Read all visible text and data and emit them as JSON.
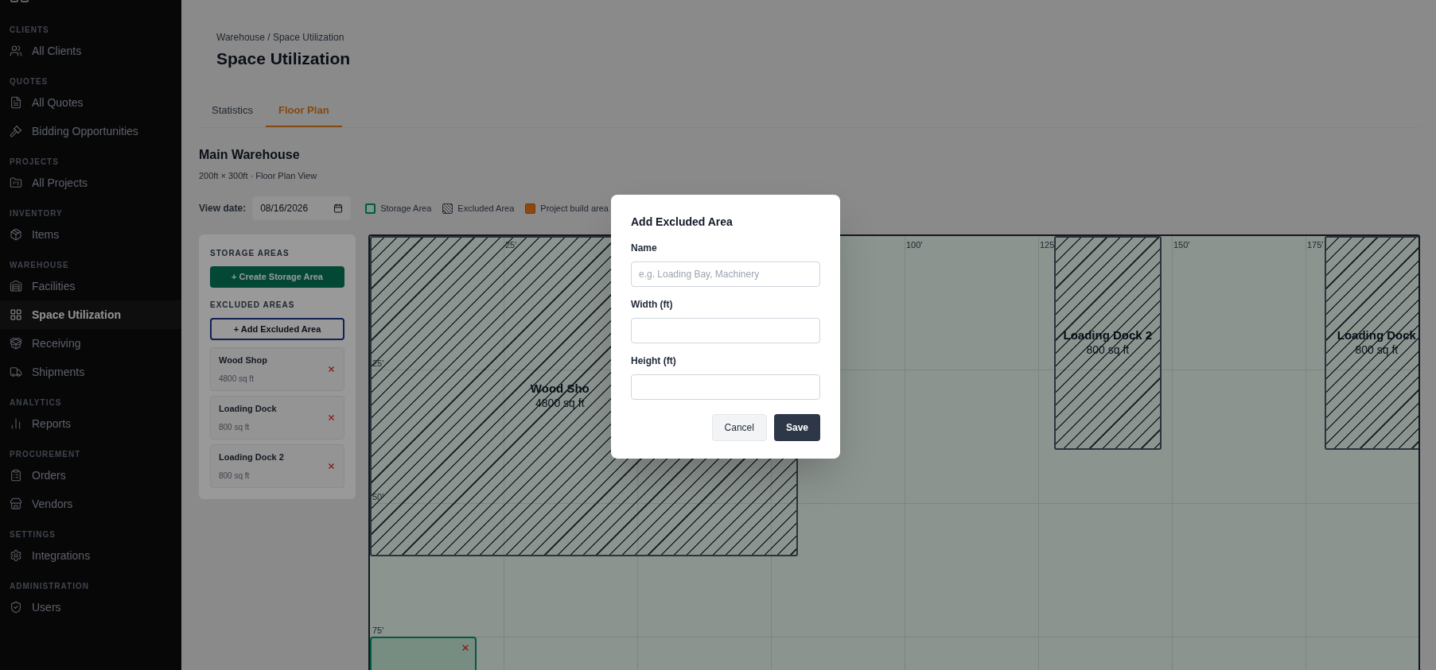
{
  "sidebar": {
    "sections": [
      {
        "label": "CLIENTS",
        "items": [
          {
            "label": "All Clients",
            "selected": false
          }
        ]
      },
      {
        "label": "QUOTES",
        "items": [
          {
            "label": "All Quotes",
            "selected": false
          },
          {
            "label": "Bidding Opportunities",
            "selected": false
          }
        ]
      },
      {
        "label": "PROJECTS",
        "items": [
          {
            "label": "All Projects",
            "selected": false
          }
        ]
      },
      {
        "label": "INVENTORY",
        "items": [
          {
            "label": "Items",
            "selected": false
          }
        ]
      },
      {
        "label": "WAREHOUSE",
        "items": [
          {
            "label": "Facilities",
            "selected": false
          },
          {
            "label": "Space Utilization",
            "selected": true
          },
          {
            "label": "Receiving",
            "selected": false
          },
          {
            "label": "Shipments",
            "selected": false
          }
        ]
      },
      {
        "label": "ANALYTICS",
        "items": [
          {
            "label": "Reports",
            "selected": false
          }
        ]
      },
      {
        "label": "PROCUREMENT",
        "items": [
          {
            "label": "Orders",
            "selected": false
          },
          {
            "label": "Vendors",
            "selected": false
          }
        ]
      },
      {
        "label": "SETTINGS",
        "items": [
          {
            "label": "Integrations",
            "selected": false
          }
        ]
      },
      {
        "label": "ADMINISTRATION",
        "items": [
          {
            "label": "Users",
            "selected": false
          }
        ]
      }
    ]
  },
  "breadcrumb": "Warehouse / Space Utilization",
  "title": "Space Utilization",
  "tabs": [
    {
      "label": "Statistics",
      "selected": false
    },
    {
      "label": "Floor Plan",
      "selected": true
    }
  ],
  "warehouse": {
    "name": "Main Warehouse",
    "subtitle": "200ft × 300ft · Floor Plan View"
  },
  "view_date": {
    "label": "View date:",
    "value": "08/16/2026"
  },
  "legend": [
    {
      "kind": "storage",
      "label": "Storage Area"
    },
    {
      "kind": "excluded",
      "label": "Excluded Area"
    },
    {
      "kind": "build",
      "label": "Project build area"
    }
  ],
  "panel": {
    "storage_heading": "STORAGE AREAS",
    "create_button": "+ Create Storage Area",
    "excluded_heading": "EXCLUDED AREAS",
    "add_button": "+ Add Excluded Area",
    "excluded_areas": [
      {
        "name": "Wood Shop",
        "area": "4800 sq ft"
      },
      {
        "name": "Loading Dock",
        "area": "800 sq ft"
      },
      {
        "name": "Loading Dock 2",
        "area": "800 sq ft"
      }
    ]
  },
  "floor_plan": {
    "x_labels": [
      "25′",
      "100′",
      "125′",
      "150′",
      "175′"
    ],
    "y_labels": [
      "25′",
      "50′",
      "75′"
    ],
    "areas": [
      {
        "kind": "excluded",
        "name": "Wood Sho",
        "area": "4800 sq ft"
      },
      {
        "kind": "excluded",
        "name": "Loading Dock 2",
        "area": "800 sq ft"
      },
      {
        "kind": "excluded",
        "name": "Loading Dock",
        "area": "800 sq ft"
      },
      {
        "kind": "storage"
      }
    ]
  },
  "modal": {
    "title": "Add Excluded Area",
    "fields": [
      {
        "label": "Name",
        "placeholder": "e.g. Loading Bay, Machinery"
      },
      {
        "label": "Width (ft)"
      },
      {
        "label": "Height (ft)"
      }
    ],
    "buttons": [
      {
        "kind": "secondary",
        "label": "Cancel"
      },
      {
        "kind": "primary",
        "label": "Save"
      }
    ]
  }
}
